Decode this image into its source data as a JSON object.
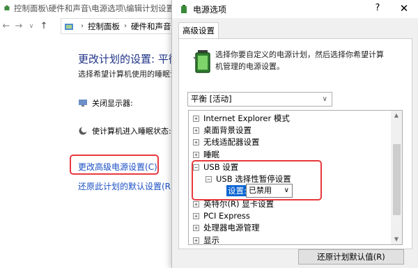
{
  "background_window": {
    "title": "控制面板\\硬件和声音\\电源选项\\编辑计划设置",
    "address": [
      "控制面板",
      "硬件和声音"
    ],
    "heading": "更改计划的设置: 平衡",
    "description": "选择希望计算机使用的睡眠设",
    "display_off_label": "关闭显示器:",
    "sleep_label": "使计算机进入睡眠状态:",
    "advanced_link": "更改高级电源设置(C)",
    "restore_link": "还原此计划的默认设置(R)"
  },
  "dialog": {
    "title": "电源选项",
    "help": "?",
    "close": "✕",
    "tab": "高级设置",
    "intro": "选择你要自定义的电源计划，然后选择你希望计算机管理的电源设置。",
    "plan": "平衡 [活动]",
    "tree": [
      {
        "label": "Internet Explorer 模式",
        "expander": "+"
      },
      {
        "label": "桌面背景设置",
        "expander": "+"
      },
      {
        "label": "无线适配器设置",
        "expander": "+"
      },
      {
        "label": "睡眠",
        "expander": "+"
      },
      {
        "label": "USB 设置",
        "expander": "−"
      },
      {
        "label": "USB 选择性暂停设置",
        "expander": "−"
      },
      {
        "label": "设置:",
        "value": "已禁用"
      },
      {
        "label": "英特尔(R) 显卡设置",
        "expander": "+"
      },
      {
        "label": "PCI Express",
        "expander": "+"
      },
      {
        "label": "处理器电源管理",
        "expander": "+"
      },
      {
        "label": "显示",
        "expander": "+"
      }
    ],
    "restore_button": "还原计划默认值(R)"
  },
  "colors": {
    "highlight_border": "#e8383d",
    "link": "#1a4fc4",
    "selection": "#0a64d2",
    "heading": "#1e3287"
  }
}
